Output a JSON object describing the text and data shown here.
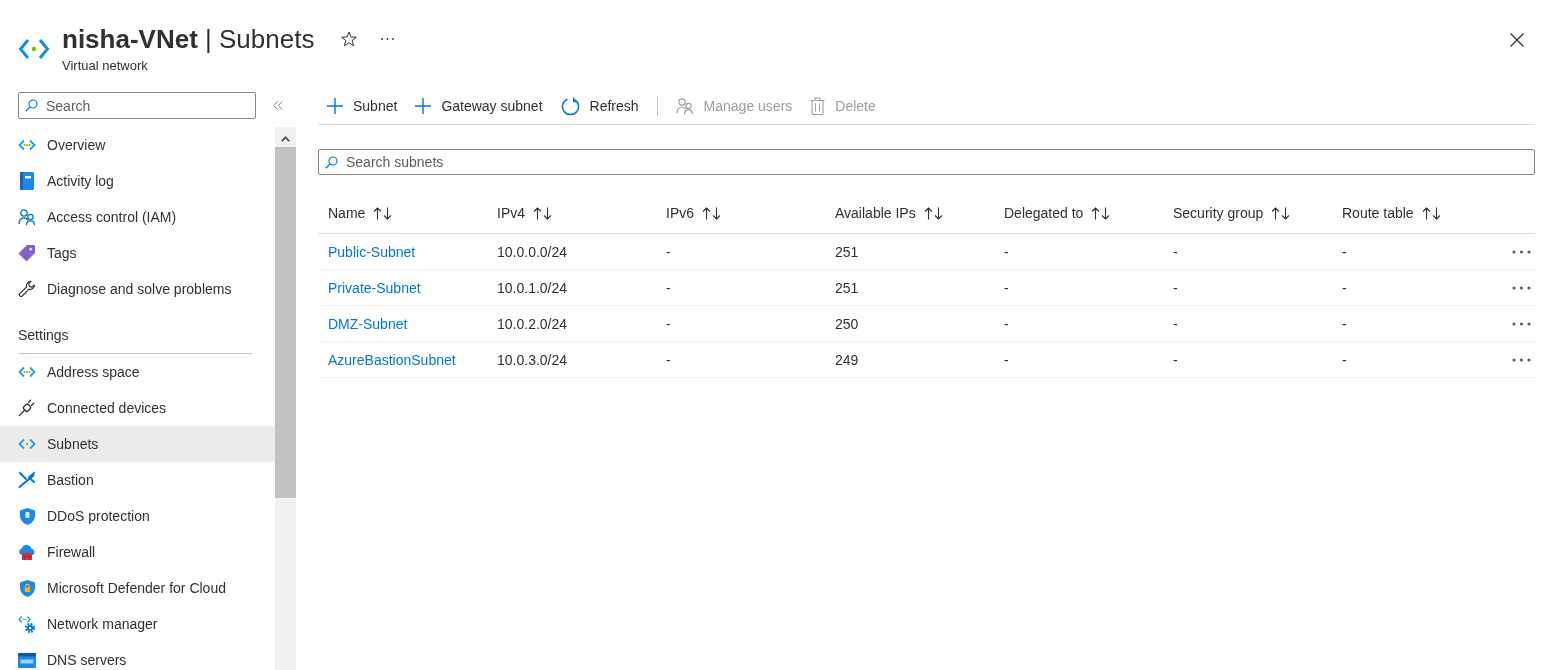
{
  "header": {
    "title": "**nisha-VNet** | Subnets",
    "subtitle": "Virtual network",
    "favorite": false
  },
  "sidebar": {
    "search": {
      "placeholder": "Search"
    },
    "sections": [
      {
        "items": [
          {
            "label": "Overview",
            "selected": false
          },
          {
            "label": "Activity log",
            "selected": false
          },
          {
            "label": "Access control (IAM)",
            "selected": false
          },
          {
            "label": "Tags",
            "selected": false
          },
          {
            "label": "Diagnose and solve problems",
            "selected": false
          }
        ]
      },
      {
        "heading": "Settings",
        "items": [
          {
            "label": "Address space",
            "selected": false
          },
          {
            "label": "Connected devices",
            "selected": false
          },
          {
            "label": "Subnets",
            "selected": true
          },
          {
            "label": "Bastion",
            "selected": false
          },
          {
            "label": "DDoS protection",
            "selected": false
          },
          {
            "label": "Firewall",
            "selected": false
          },
          {
            "label": "Microsoft Defender for Cloud",
            "selected": false
          },
          {
            "label": "Network manager",
            "selected": false
          },
          {
            "label": "DNS servers",
            "selected": false
          }
        ]
      }
    ]
  },
  "toolbar": {
    "groups": [
      {
        "buttons": [
          {
            "label": "Subnet",
            "disabled": false
          },
          {
            "label": "Gateway subnet",
            "disabled": false
          },
          {
            "label": "Refresh",
            "disabled": false
          }
        ]
      },
      {
        "buttons": [
          {
            "label": "Manage users",
            "disabled": true
          },
          {
            "label": "Delete",
            "disabled": true
          }
        ]
      }
    ]
  },
  "search": {
    "placeholder": "Search subnets"
  },
  "table": {
    "columns": [
      "Name",
      "IPv4",
      "IPv6",
      "Available IPs",
      "Delegated to",
      "Security group",
      "Route table"
    ],
    "rows": [
      {
        "cells": [
          "Public-Subnet",
          "10.0.0.0/24",
          "-",
          "251",
          "-",
          "-",
          "-"
        ]
      },
      {
        "cells": [
          "Private-Subnet",
          "10.0.1.0/24",
          "-",
          "251",
          "-",
          "-",
          "-"
        ]
      },
      {
        "cells": [
          "DMZ-Subnet",
          "10.0.2.0/24",
          "-",
          "250",
          "-",
          "-",
          "-"
        ]
      },
      {
        "cells": [
          "AzureBastionSubnet",
          "10.0.3.0/24",
          "-",
          "249",
          "-",
          "-",
          "-"
        ]
      }
    ]
  }
}
